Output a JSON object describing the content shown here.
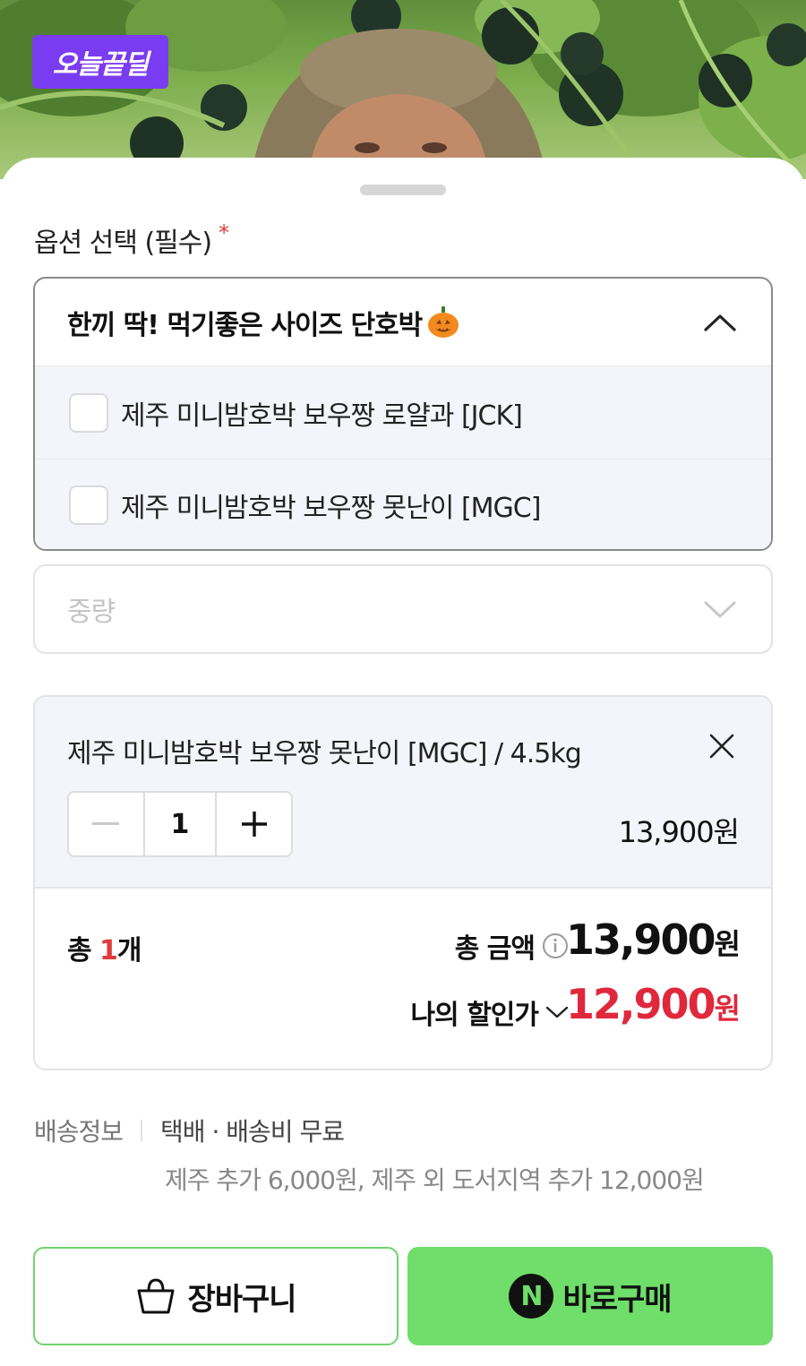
{
  "hero": {
    "badge": "오늘끝딜",
    "image_description_icon": "farmer-pumpkin-photo"
  },
  "option_section": {
    "heading": "옵션 선택 (필수)",
    "required_mark": "*",
    "dropdown_title": "한끼 딱! 먹기좋은 사이즈 단호박",
    "items": [
      {
        "label": "제주 미니밤호박 보우짱 로얄과 [JCK]",
        "checked": false
      },
      {
        "label": "제주 미니밤호박 보우짱 못난이 [MGC]",
        "checked": false
      }
    ],
    "weight_placeholder": "중량"
  },
  "selected": {
    "name": "제주 미니밤호박 보우짱 못난이 [MGC] / 4.5kg",
    "quantity": "1",
    "price": "13,900원"
  },
  "summary": {
    "count_prefix": "총 ",
    "count": "1",
    "count_suffix": "개",
    "total_label": "총 금액",
    "total_value": "13,900",
    "total_unit": "원",
    "discount_label": "나의 할인가",
    "discount_value": "12,900",
    "discount_unit": "원"
  },
  "shipping": {
    "label": "배송정보",
    "value": "택배 · 배송비 무료",
    "note": "제주 추가 6,000원, 제주 외 도서지역 추가 12,000원"
  },
  "buttons": {
    "cart": "장바구니",
    "buy": "바로구매",
    "npay_letter": "N"
  },
  "colors": {
    "badge": "#7a3cf0",
    "required": "#e03a3a",
    "discount": "#e0283c",
    "buy_button": "#6fde6a",
    "cart_border": "#6fd56a"
  }
}
